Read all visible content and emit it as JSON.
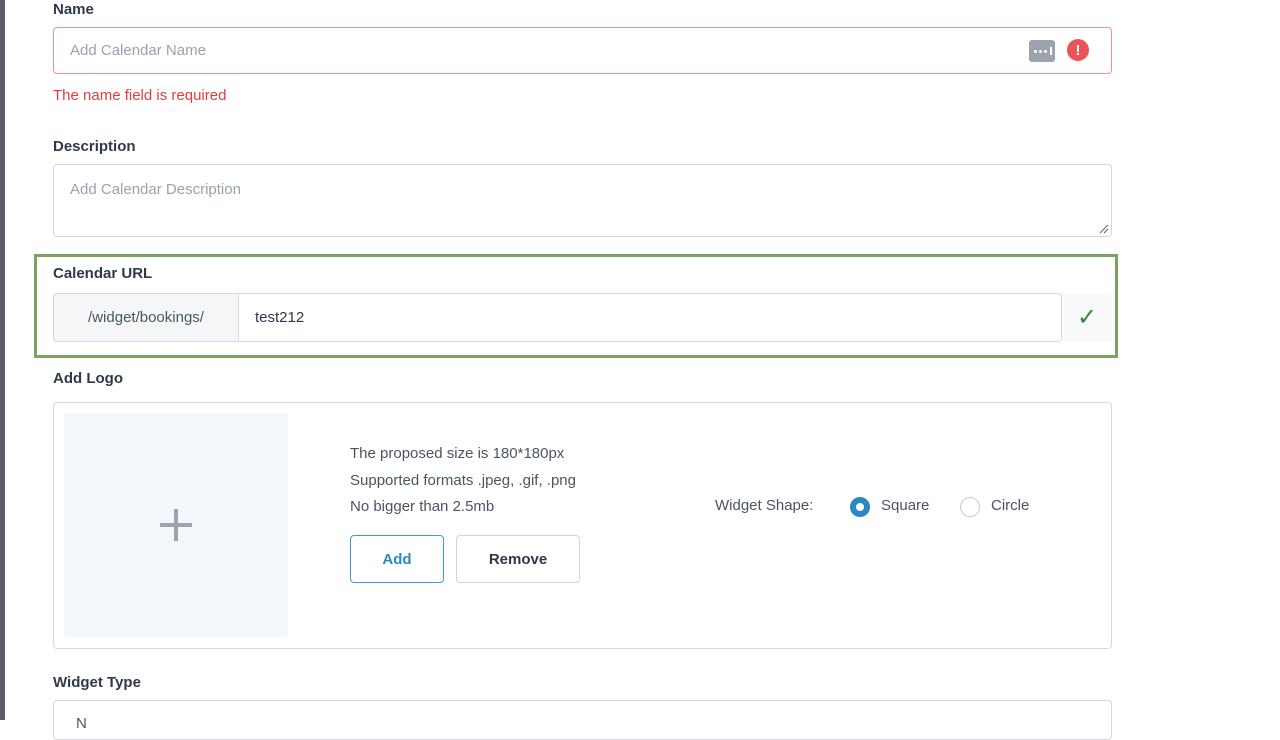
{
  "name": {
    "label": "Name",
    "placeholder": "Add Calendar Name",
    "error": "The name field is required"
  },
  "description": {
    "label": "Description",
    "placeholder": "Add Calendar Description"
  },
  "calendar_url": {
    "label": "Calendar URL",
    "prefix": "/widget/bookings/",
    "value": "test212",
    "valid_icon": "check-icon",
    "valid_color": "#2f8d2f"
  },
  "logo": {
    "label": "Add Logo",
    "info": [
      "The proposed size is 180*180px",
      "Supported formats .jpeg, .gif, .png",
      "No bigger than 2.5mb"
    ],
    "add_label": "Add",
    "remove_label": "Remove",
    "shape_label": "Widget Shape:",
    "shapes": [
      "Square",
      "Circle"
    ],
    "selected_shape": "Square"
  },
  "widget_type": {
    "label": "Widget Type",
    "value": "N"
  },
  "colors": {
    "error": "#e13d3d",
    "accent": "#2c88c3",
    "highlight": "#7ea060"
  }
}
